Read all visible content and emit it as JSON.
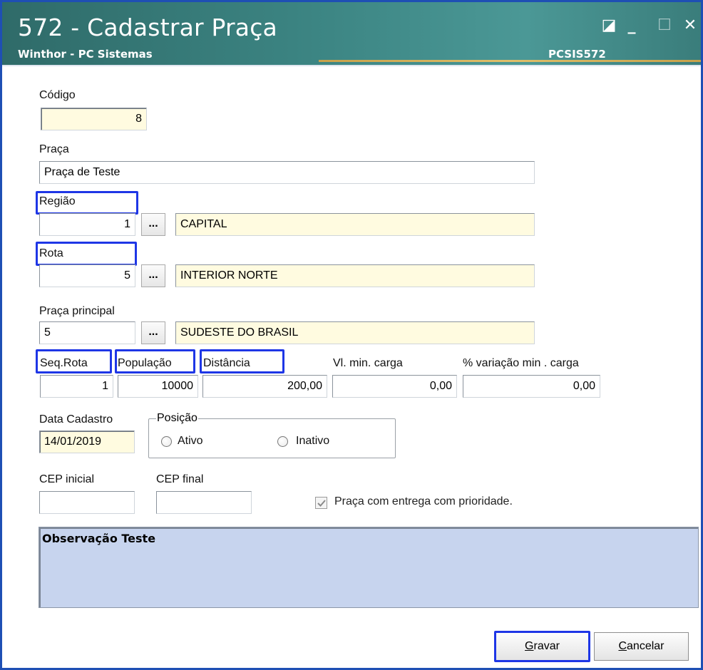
{
  "window": {
    "title": "572 - Cadastrar Praça",
    "subtitle": "Winthor - PC Sistemas",
    "program_code": "PCSIS572",
    "controls": {
      "restore": "◪",
      "minimize": "_",
      "maximize": "☐",
      "close": "✕"
    }
  },
  "codigo": {
    "label": "Código",
    "value": "8"
  },
  "praca": {
    "label": "Praça",
    "value": "Praça de Teste"
  },
  "regiao": {
    "label": "Região",
    "code": "1",
    "button": "...",
    "name": "CAPITAL"
  },
  "rota": {
    "label": "Rota",
    "code": "5",
    "button": "...",
    "name": "INTERIOR NORTE"
  },
  "praca_principal": {
    "label": "Praça principal",
    "code": "5",
    "button": "...",
    "name": "SUDESTE DO BRASIL"
  },
  "seq_rota": {
    "label": "Seq.Rota",
    "value": "1"
  },
  "populacao": {
    "label": "População",
    "value": "10000"
  },
  "distancia": {
    "label": "Distância",
    "value": "200,00"
  },
  "vl_min_carga": {
    "label": "Vl. min. carga",
    "value": "0,00"
  },
  "variacao_min_carga": {
    "label": "% variação min . carga",
    "value": "0,00"
  },
  "data_cadastro": {
    "label": "Data Cadastro",
    "value": "14/01/2019"
  },
  "posicao": {
    "label": "Posição",
    "options": [
      {
        "label": "Ativo",
        "selected": false
      },
      {
        "label": "Inativo",
        "selected": false
      }
    ]
  },
  "cep_inicial": {
    "label": "CEP inicial",
    "value": ""
  },
  "cep_final": {
    "label": "CEP final",
    "value": ""
  },
  "prioridade": {
    "label": "Praça com entrega com prioridade.",
    "checked": true,
    "disabled": true
  },
  "observacao": {
    "value": "Observação Teste"
  },
  "buttons": {
    "gravar": {
      "accel": "G",
      "rest": "ravar"
    },
    "cancelar": {
      "accel": "C",
      "rest": "ancelar"
    }
  },
  "colors": {
    "titlebar": "#3c8583",
    "highlight": "#1e36e6",
    "readonly_field": "#fffbe0",
    "observacao_bg": "#c7d4ee",
    "window_border": "#1e4fb4"
  }
}
